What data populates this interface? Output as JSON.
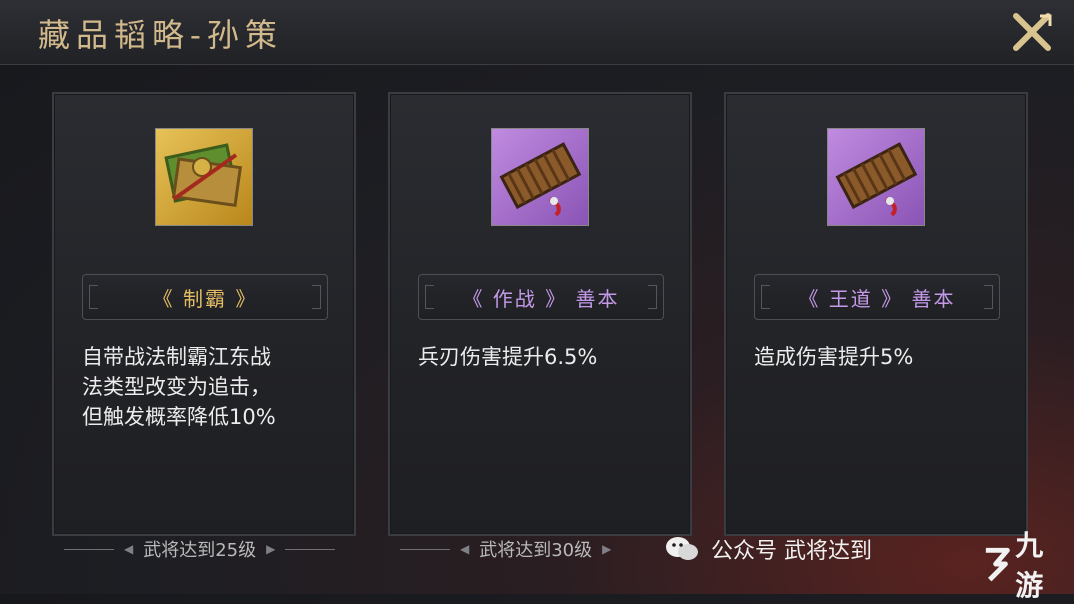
{
  "header": {
    "title": "藏品韬略-孙策"
  },
  "cards": [
    {
      "name": "《 制霸 》",
      "description": "自带战法制霸江东战\n法类型改变为追击，\n但触发概率降低10%",
      "requirement": "武将达到25级",
      "rarity_color": "#e4bd63"
    },
    {
      "name": "《 作战 》 善本",
      "description": "兵刃伤害提升6.5%",
      "requirement": "武将达到30级",
      "rarity_color": "#c49ae8"
    },
    {
      "name": "《 王道 》 善本",
      "description": "造成伤害提升5%",
      "requirement": "",
      "rarity_color": "#c49ae8"
    }
  ],
  "watermark": {
    "text": "公众号 武将达到"
  },
  "brand": {
    "logo_text": "九游"
  },
  "icons": [
    "close-x-icon",
    "tactic-book-gold-icon",
    "tactic-book-purple-icon",
    "wechat-icon",
    "jiuyou-logo-icon"
  ]
}
